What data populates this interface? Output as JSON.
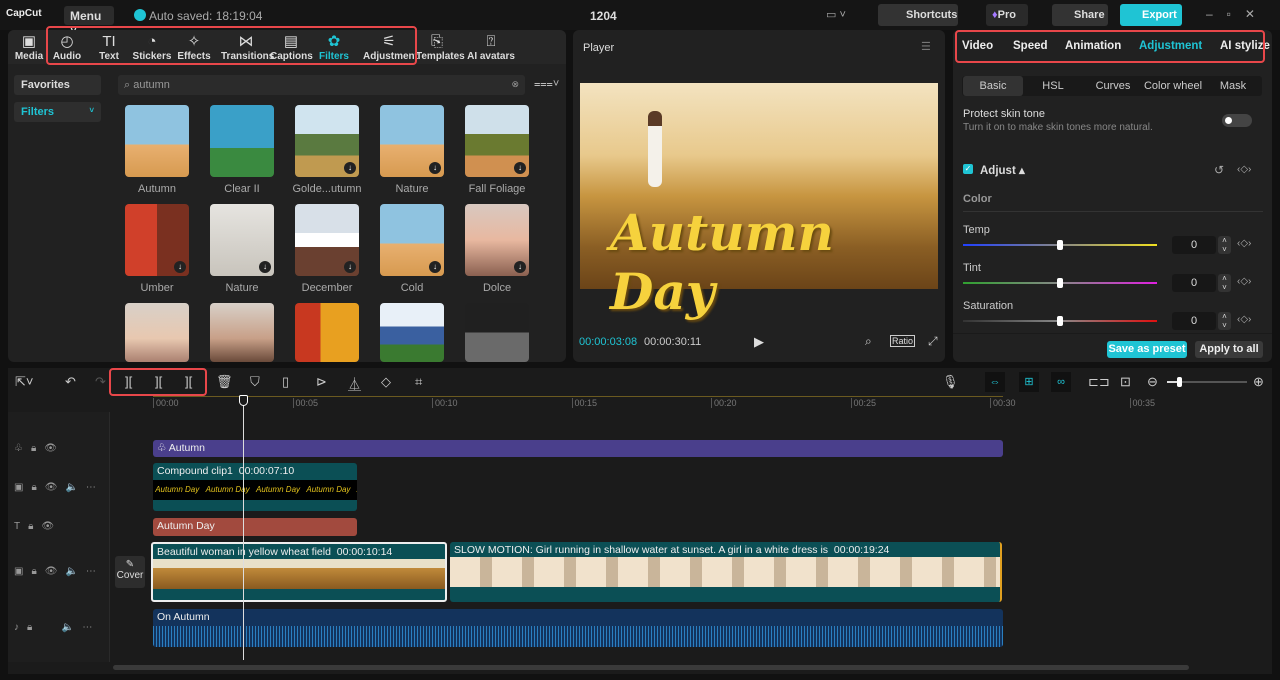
{
  "app": {
    "logo": "CapCut",
    "menu": "Menu",
    "autosave": "Auto saved: 18:19:04",
    "project": "1204",
    "shortcuts": "Shortcuts",
    "pro": "Pro",
    "share": "Share",
    "export": "Export"
  },
  "tabs": [
    {
      "label": "Media",
      "icon": "▣"
    },
    {
      "label": "Audio",
      "icon": "◴"
    },
    {
      "label": "Text",
      "icon": "TI"
    },
    {
      "label": "Stickers",
      "icon": "◔"
    },
    {
      "label": "Effects",
      "icon": "✧"
    },
    {
      "label": "Transitions",
      "icon": "⋈"
    },
    {
      "label": "Captions",
      "icon": "▤"
    },
    {
      "label": "Filters",
      "icon": "✿"
    },
    {
      "label": "Adjustment",
      "icon": "⚟"
    },
    {
      "label": "Templates",
      "icon": "⎘"
    },
    {
      "label": "AI avatars",
      "icon": "⍰"
    }
  ],
  "sidebar": {
    "favorites": "Favorites",
    "filters": "Filters"
  },
  "search": {
    "value": "autumn"
  },
  "filters": [
    {
      "label": "Autumn"
    },
    {
      "label": "Clear II"
    },
    {
      "label": "Golde...utumn"
    },
    {
      "label": "Nature"
    },
    {
      "label": "Fall Foliage"
    },
    {
      "label": "Umber"
    },
    {
      "label": "Nature"
    },
    {
      "label": "December"
    },
    {
      "label": "Cold"
    },
    {
      "label": "Dolce"
    }
  ],
  "player": {
    "title": "Player",
    "overlay": "Autumn Day",
    "current": "00:00:03:08",
    "total": "00:00:30:11",
    "ratio": "Ratio"
  },
  "right": {
    "tabs": [
      "Video",
      "Speed",
      "Animation",
      "Adjustment",
      "AI stylize"
    ],
    "subtabs": [
      "Basic",
      "HSL",
      "Curves",
      "Color wheel",
      "Mask"
    ],
    "protect_title": "Protect skin tone",
    "protect_desc": "Turn it on to make skin tones more natural.",
    "adjust": "Adjust",
    "color": "Color",
    "sliders": [
      {
        "label": "Temp",
        "value": "0"
      },
      {
        "label": "Tint",
        "value": "0"
      },
      {
        "label": "Saturation",
        "value": "0"
      }
    ],
    "save_preset": "Save as preset",
    "apply_all": "Apply to all"
  },
  "ruler": [
    "00:00",
    "00:05",
    "00:10",
    "00:15",
    "00:20",
    "00:25",
    "00:30",
    "00:35"
  ],
  "timeline": {
    "filter_clip": "Autumn",
    "compound": "Compound clip1",
    "compound_dur": "00:00:07:10",
    "text_clip": "Autumn Day",
    "cover": "Cover",
    "main1": "Beautiful woman in yellow wheat field",
    "main1_dur": "00:00:10:14",
    "main2": "SLOW MOTION: Girl running in shallow water at sunset. A girl in a white dress is",
    "main2_dur": "00:00:19:24",
    "audio": "On Autumn"
  },
  "colors": {
    "accent": "#1fc4d4",
    "filter_track": "#4a3f8c",
    "teal": "#0b4f55",
    "text_track": "#a24a3e",
    "audio": "#13335c"
  }
}
